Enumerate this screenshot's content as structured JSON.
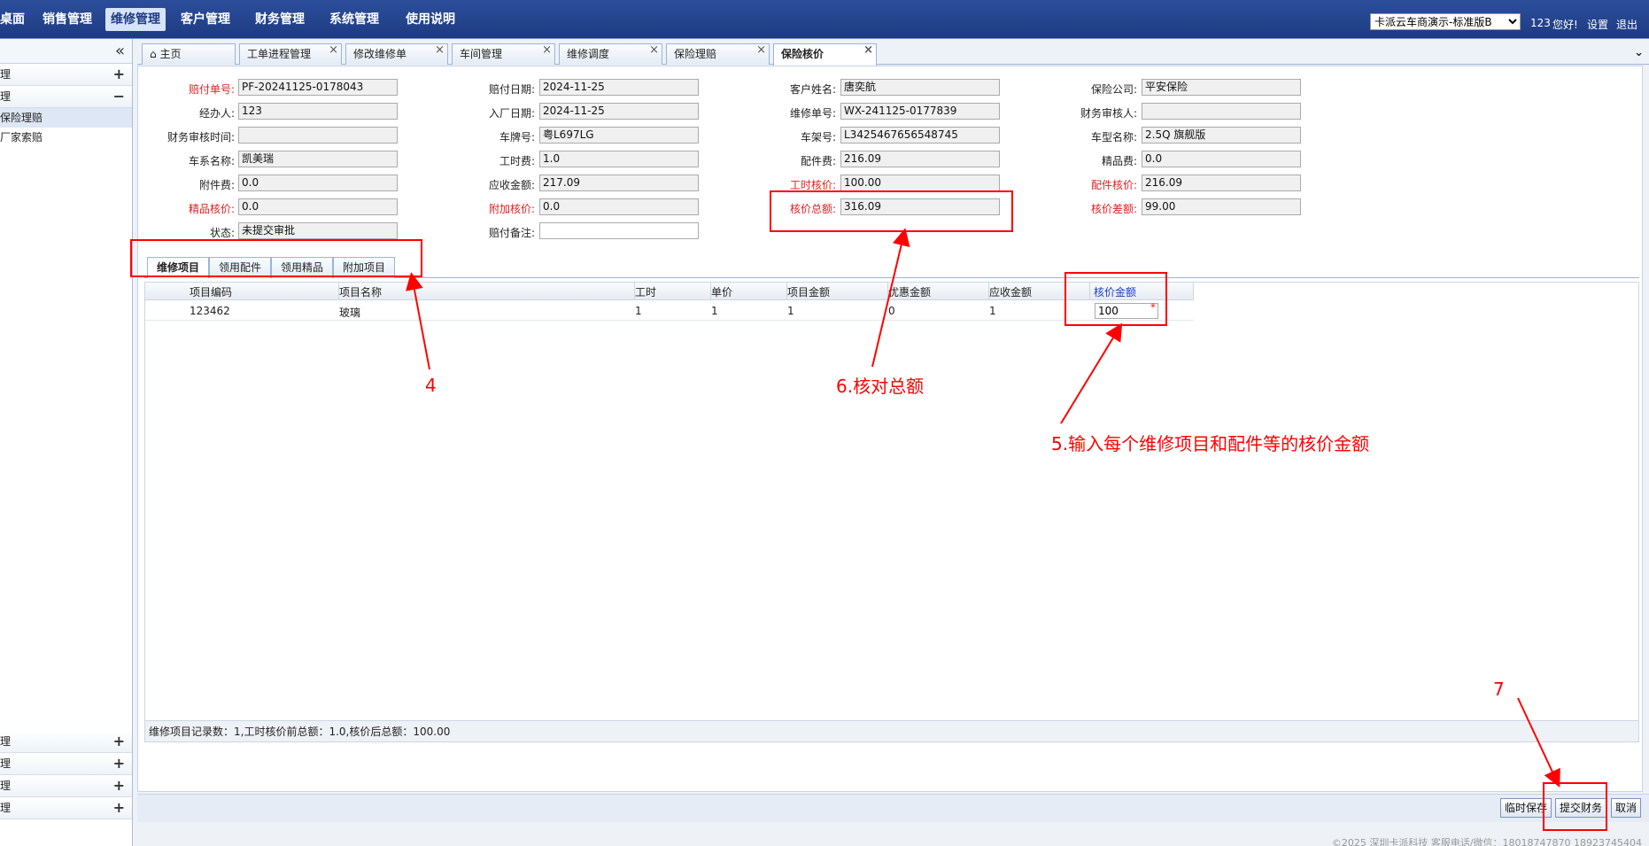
{
  "nav": {
    "items": [
      "桌面",
      "销售管理",
      "维修管理",
      "客户管理",
      "财务管理",
      "系统管理",
      "使用说明"
    ],
    "active_index": 2,
    "store_select": "卡派云车商演示-标准版B",
    "user": "123",
    "greeting": "您好!",
    "settings": "设置",
    "logout": "退出"
  },
  "sidebar": {
    "collapse_glyph": "«",
    "top_groups": [
      {
        "label": "理",
        "sign": "+"
      },
      {
        "label": "理",
        "sign": "−"
      }
    ],
    "sub_items": [
      "保险理赔",
      "厂家索赔"
    ],
    "selected_sub": 0,
    "bottom_groups": [
      {
        "label": "理",
        "sign": "+"
      },
      {
        "label": "理",
        "sign": "+"
      },
      {
        "label": "理",
        "sign": "+"
      },
      {
        "label": "理",
        "sign": "+"
      }
    ]
  },
  "tabs": [
    "主页",
    "工单进程管理",
    "修改维修单",
    "车间管理",
    "维修调度",
    "保险理赔",
    "保险核价"
  ],
  "active_tab": 6,
  "form": {
    "col1": [
      {
        "label": "赔付单号:",
        "value": "PF-20241125-0178043",
        "red": true
      },
      {
        "label": "经办人:",
        "value": "123",
        "red": false
      },
      {
        "label": "财务审核时间:",
        "value": "",
        "red": false
      },
      {
        "label": "车系名称:",
        "value": "凯美瑞",
        "red": false
      },
      {
        "label": "附件费:",
        "value": "0.0",
        "red": false
      },
      {
        "label": "精品核价:",
        "value": "0.0",
        "red": true
      },
      {
        "label": "状态:",
        "value": "未提交审批",
        "red": false
      }
    ],
    "col2": [
      {
        "label": "赔付日期:",
        "value": "2024-11-25",
        "red": false
      },
      {
        "label": "入厂日期:",
        "value": "2024-11-25",
        "red": false
      },
      {
        "label": "车牌号:",
        "value": "粤L697LG",
        "red": false
      },
      {
        "label": "工时费:",
        "value": "1.0",
        "red": false
      },
      {
        "label": "应收金额:",
        "value": "217.09",
        "red": false
      },
      {
        "label": "附加核价:",
        "value": "0.0",
        "red": true
      },
      {
        "label": "赔付备注:",
        "value": "",
        "red": false,
        "white": true
      }
    ],
    "col3": [
      {
        "label": "客户姓名:",
        "value": "唐奕航",
        "red": false
      },
      {
        "label": "维修单号:",
        "value": "WX-241125-0177839",
        "red": false
      },
      {
        "label": "车架号:",
        "value": "L3425467656548745",
        "red": false
      },
      {
        "label": "配件费:",
        "value": "216.09",
        "red": false
      },
      {
        "label": "工时核价:",
        "value": "100.00",
        "red": true
      },
      {
        "label": "核价总额:",
        "value": "316.09",
        "red": true
      }
    ],
    "col4": [
      {
        "label": "保险公司:",
        "value": "平安保险",
        "red": false
      },
      {
        "label": "财务审核人:",
        "value": "",
        "red": false
      },
      {
        "label": "车型名称:",
        "value": "2.5Q 旗舰版",
        "red": false
      },
      {
        "label": "精品费:",
        "value": "0.0",
        "red": false
      },
      {
        "label": "配件核价:",
        "value": "216.09",
        "red": true
      },
      {
        "label": "核价差额:",
        "value": "99.00",
        "red": true
      }
    ]
  },
  "subtabs": [
    "维修项目",
    "领用配件",
    "领用精品",
    "附加项目"
  ],
  "grid": {
    "headers": [
      "项目编码",
      "项目名称",
      "工时",
      "单价",
      "项目金额",
      "优惠金额",
      "应收金额",
      "核价金额"
    ],
    "rows": [
      [
        "123462",
        "玻璃",
        "1",
        "1",
        "1",
        "0",
        "1",
        "100"
      ]
    ],
    "required_mark": "*",
    "footer": "维修项目记录数：1,工时核价前总额：1.0,核价后总额：100.00"
  },
  "buttons": {
    "temp_save": "临时保存",
    "submit_finance": "提交财务",
    "cancel": "取消"
  },
  "copyright": "©2025 深圳卡派科技 客服电话/微信：18018747870 18923745404",
  "annotations": {
    "step4": "4",
    "step5": "5.输入每个维修项目和配件等的核价金额",
    "step6": "6.核对总额",
    "step7": "7"
  },
  "colors": {
    "nav_bg": "#1d3b82",
    "annotation": "#ff0000",
    "label_red": "#e02020"
  }
}
